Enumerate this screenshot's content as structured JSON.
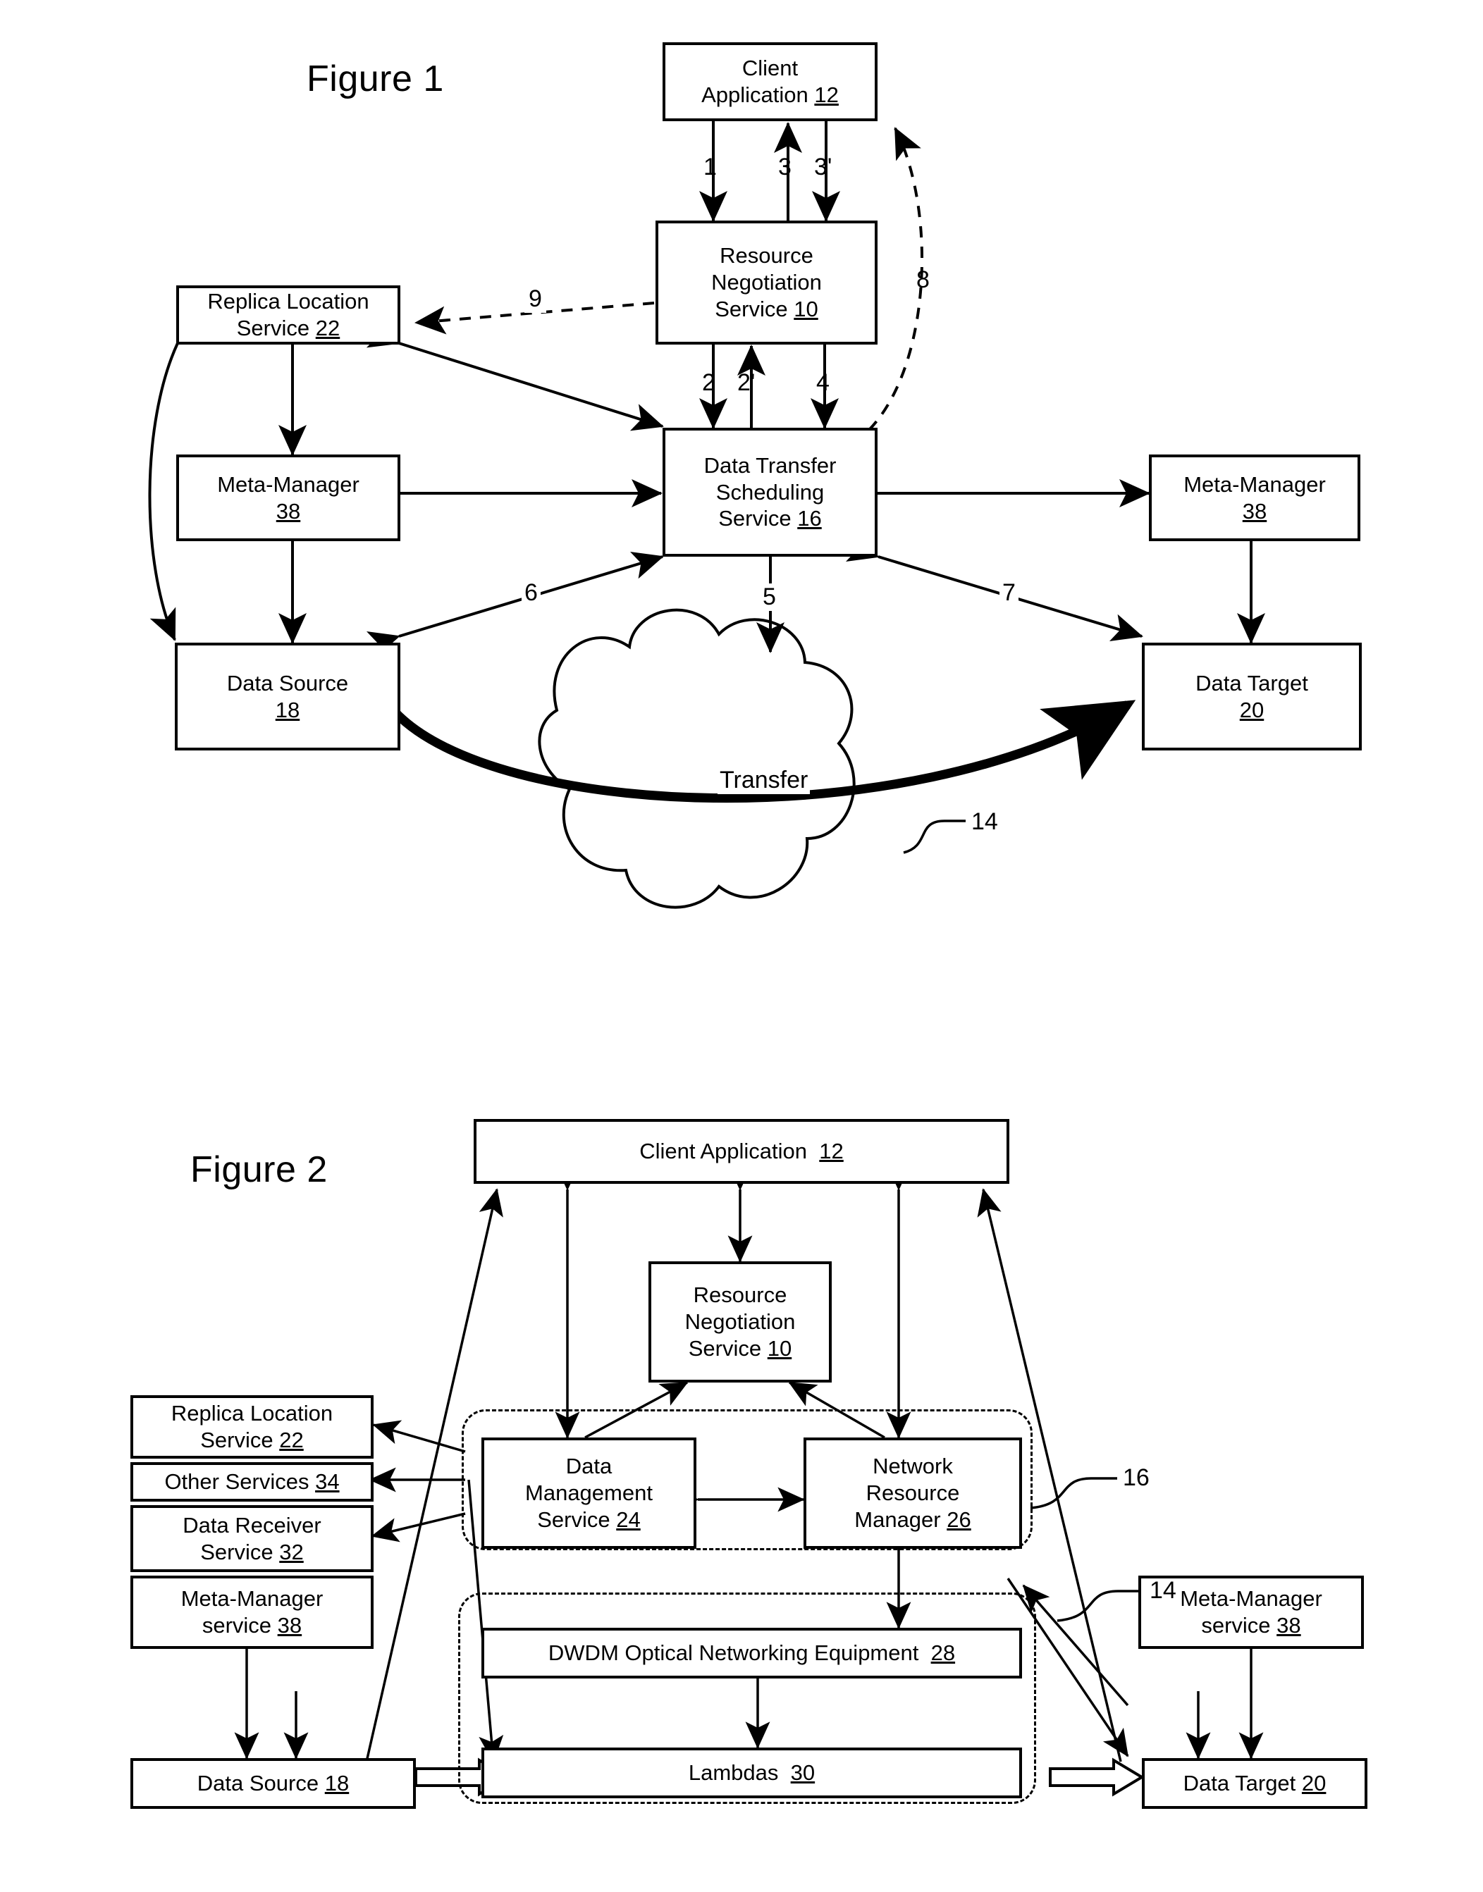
{
  "figure1": {
    "title": "Figure 1",
    "boxes": {
      "client_application": {
        "line1": "Client",
        "line2": "Application",
        "ref": "12"
      },
      "resource_negotiation": {
        "line1": "Resource",
        "line2": "Negotiation",
        "line3": "Service",
        "ref": "10"
      },
      "replica_location": {
        "line1": "Replica Location",
        "line2": "Service",
        "ref": "22"
      },
      "meta_manager_left": {
        "line1": "Meta-Manager",
        "ref": "38"
      },
      "data_transfer_scheduling": {
        "line1": "Data Transfer",
        "line2": "Scheduling",
        "line3": "Service",
        "ref": "16"
      },
      "meta_manager_right": {
        "line1": "Meta-Manager",
        "ref": "38"
      },
      "data_source": {
        "line1": "Data Source",
        "ref": "18"
      },
      "data_target": {
        "line1": "Data Target",
        "ref": "20"
      }
    },
    "cloud_label": "Transfer",
    "cloud_ref": "14",
    "arrow_labels": {
      "a1": "1",
      "a3": "3",
      "a3p": "3'",
      "a8": "8",
      "a9": "9",
      "a2": "2",
      "a2p": "2'",
      "a4": "4",
      "a6": "6",
      "a5": "5",
      "a7": "7"
    }
  },
  "figure2": {
    "title": "Figure 2",
    "boxes": {
      "client_application": {
        "line1": "Client Application",
        "ref": "12"
      },
      "resource_negotiation": {
        "line1": "Resource",
        "line2": "Negotiation",
        "line3": "Service",
        "ref": "10"
      },
      "replica_location": {
        "line1": "Replica Location",
        "line2": "Service",
        "ref": "22"
      },
      "other_services": {
        "line1": "Other Services",
        "ref": "34"
      },
      "data_receiver": {
        "line1": "Data Receiver",
        "line2": "Service",
        "ref": "32"
      },
      "meta_manager_left": {
        "line1": "Meta-Manager",
        "line2": "service",
        "ref": "38"
      },
      "data_management": {
        "line1": "Data",
        "line2": "Management",
        "line3": "Service",
        "ref": "24"
      },
      "network_resource_manager": {
        "line1": "Network",
        "line2": "Resource",
        "line3": "Manager",
        "ref": "26"
      },
      "dwdm": {
        "line1": "DWDM Optical Networking Equipment",
        "ref": "28"
      },
      "lambdas": {
        "line1": "Lambdas",
        "ref": "30"
      },
      "meta_manager_right": {
        "line1": "Meta-Manager",
        "line2": "service",
        "ref": "38"
      },
      "data_source": {
        "line1": "Data Source",
        "ref": "18"
      },
      "data_target": {
        "line1": "Data Target",
        "ref": "20"
      }
    },
    "ref_labels": {
      "r16": "16",
      "r14": "14"
    }
  }
}
